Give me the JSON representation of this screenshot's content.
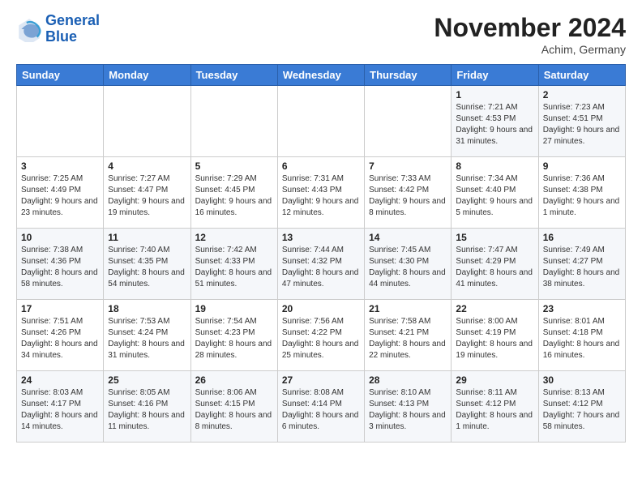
{
  "logo": {
    "line1": "General",
    "line2": "Blue"
  },
  "header": {
    "title": "November 2024",
    "location": "Achim, Germany"
  },
  "weekdays": [
    "Sunday",
    "Monday",
    "Tuesday",
    "Wednesday",
    "Thursday",
    "Friday",
    "Saturday"
  ],
  "weeks": [
    [
      {
        "day": "",
        "info": ""
      },
      {
        "day": "",
        "info": ""
      },
      {
        "day": "",
        "info": ""
      },
      {
        "day": "",
        "info": ""
      },
      {
        "day": "",
        "info": ""
      },
      {
        "day": "1",
        "info": "Sunrise: 7:21 AM\nSunset: 4:53 PM\nDaylight: 9 hours\nand 31 minutes."
      },
      {
        "day": "2",
        "info": "Sunrise: 7:23 AM\nSunset: 4:51 PM\nDaylight: 9 hours\nand 27 minutes."
      }
    ],
    [
      {
        "day": "3",
        "info": "Sunrise: 7:25 AM\nSunset: 4:49 PM\nDaylight: 9 hours\nand 23 minutes."
      },
      {
        "day": "4",
        "info": "Sunrise: 7:27 AM\nSunset: 4:47 PM\nDaylight: 9 hours\nand 19 minutes."
      },
      {
        "day": "5",
        "info": "Sunrise: 7:29 AM\nSunset: 4:45 PM\nDaylight: 9 hours\nand 16 minutes."
      },
      {
        "day": "6",
        "info": "Sunrise: 7:31 AM\nSunset: 4:43 PM\nDaylight: 9 hours\nand 12 minutes."
      },
      {
        "day": "7",
        "info": "Sunrise: 7:33 AM\nSunset: 4:42 PM\nDaylight: 9 hours\nand 8 minutes."
      },
      {
        "day": "8",
        "info": "Sunrise: 7:34 AM\nSunset: 4:40 PM\nDaylight: 9 hours\nand 5 minutes."
      },
      {
        "day": "9",
        "info": "Sunrise: 7:36 AM\nSunset: 4:38 PM\nDaylight: 9 hours\nand 1 minute."
      }
    ],
    [
      {
        "day": "10",
        "info": "Sunrise: 7:38 AM\nSunset: 4:36 PM\nDaylight: 8 hours\nand 58 minutes."
      },
      {
        "day": "11",
        "info": "Sunrise: 7:40 AM\nSunset: 4:35 PM\nDaylight: 8 hours\nand 54 minutes."
      },
      {
        "day": "12",
        "info": "Sunrise: 7:42 AM\nSunset: 4:33 PM\nDaylight: 8 hours\nand 51 minutes."
      },
      {
        "day": "13",
        "info": "Sunrise: 7:44 AM\nSunset: 4:32 PM\nDaylight: 8 hours\nand 47 minutes."
      },
      {
        "day": "14",
        "info": "Sunrise: 7:45 AM\nSunset: 4:30 PM\nDaylight: 8 hours\nand 44 minutes."
      },
      {
        "day": "15",
        "info": "Sunrise: 7:47 AM\nSunset: 4:29 PM\nDaylight: 8 hours\nand 41 minutes."
      },
      {
        "day": "16",
        "info": "Sunrise: 7:49 AM\nSunset: 4:27 PM\nDaylight: 8 hours\nand 38 minutes."
      }
    ],
    [
      {
        "day": "17",
        "info": "Sunrise: 7:51 AM\nSunset: 4:26 PM\nDaylight: 8 hours\nand 34 minutes."
      },
      {
        "day": "18",
        "info": "Sunrise: 7:53 AM\nSunset: 4:24 PM\nDaylight: 8 hours\nand 31 minutes."
      },
      {
        "day": "19",
        "info": "Sunrise: 7:54 AM\nSunset: 4:23 PM\nDaylight: 8 hours\nand 28 minutes."
      },
      {
        "day": "20",
        "info": "Sunrise: 7:56 AM\nSunset: 4:22 PM\nDaylight: 8 hours\nand 25 minutes."
      },
      {
        "day": "21",
        "info": "Sunrise: 7:58 AM\nSunset: 4:21 PM\nDaylight: 8 hours\nand 22 minutes."
      },
      {
        "day": "22",
        "info": "Sunrise: 8:00 AM\nSunset: 4:19 PM\nDaylight: 8 hours\nand 19 minutes."
      },
      {
        "day": "23",
        "info": "Sunrise: 8:01 AM\nSunset: 4:18 PM\nDaylight: 8 hours\nand 16 minutes."
      }
    ],
    [
      {
        "day": "24",
        "info": "Sunrise: 8:03 AM\nSunset: 4:17 PM\nDaylight: 8 hours\nand 14 minutes."
      },
      {
        "day": "25",
        "info": "Sunrise: 8:05 AM\nSunset: 4:16 PM\nDaylight: 8 hours\nand 11 minutes."
      },
      {
        "day": "26",
        "info": "Sunrise: 8:06 AM\nSunset: 4:15 PM\nDaylight: 8 hours\nand 8 minutes."
      },
      {
        "day": "27",
        "info": "Sunrise: 8:08 AM\nSunset: 4:14 PM\nDaylight: 8 hours\nand 6 minutes."
      },
      {
        "day": "28",
        "info": "Sunrise: 8:10 AM\nSunset: 4:13 PM\nDaylight: 8 hours\nand 3 minutes."
      },
      {
        "day": "29",
        "info": "Sunrise: 8:11 AM\nSunset: 4:12 PM\nDaylight: 8 hours\nand 1 minute."
      },
      {
        "day": "30",
        "info": "Sunrise: 8:13 AM\nSunset: 4:12 PM\nDaylight: 7 hours\nand 58 minutes."
      }
    ]
  ]
}
